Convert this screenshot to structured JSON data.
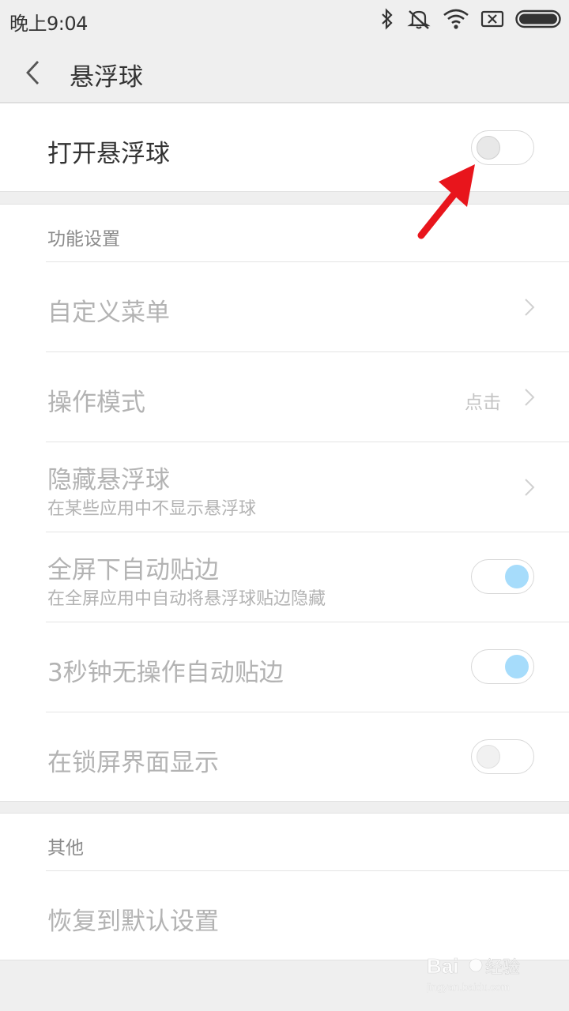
{
  "status_bar": {
    "time": "晚上9:04",
    "icons": [
      "bluetooth-icon",
      "mute-icon",
      "wifi-icon",
      "sim-icon",
      "battery-icon"
    ]
  },
  "header": {
    "title": "悬浮球",
    "back_icon": "back-arrow-icon"
  },
  "main_toggle": {
    "label": "打开悬浮球",
    "state": "off"
  },
  "function_settings": {
    "section_title": "功能设置",
    "items": [
      {
        "label": "自定义菜单",
        "value": "",
        "control": "chevron"
      },
      {
        "label": "操作模式",
        "value": "点击",
        "control": "chevron"
      },
      {
        "label": "隐藏悬浮球",
        "sublabel": "在某些应用中不显示悬浮球",
        "control": "chevron"
      },
      {
        "label": "全屏下自动贴边",
        "sublabel": "在全屏应用中自动将悬浮球贴边隐藏",
        "control": "toggle",
        "state": "on"
      },
      {
        "label": "3秒钟无操作自动贴边",
        "control": "toggle",
        "state": "on"
      },
      {
        "label": "在锁屏界面显示",
        "control": "toggle",
        "state": "off"
      }
    ]
  },
  "other": {
    "section_title": "其他",
    "items": [
      {
        "label": "恢复到默认设置"
      }
    ]
  },
  "colors": {
    "accent": "#a6dcfb",
    "annotation_arrow": "#e8151c"
  },
  "watermark": "Baidu经验 jingyan.baidu.com"
}
